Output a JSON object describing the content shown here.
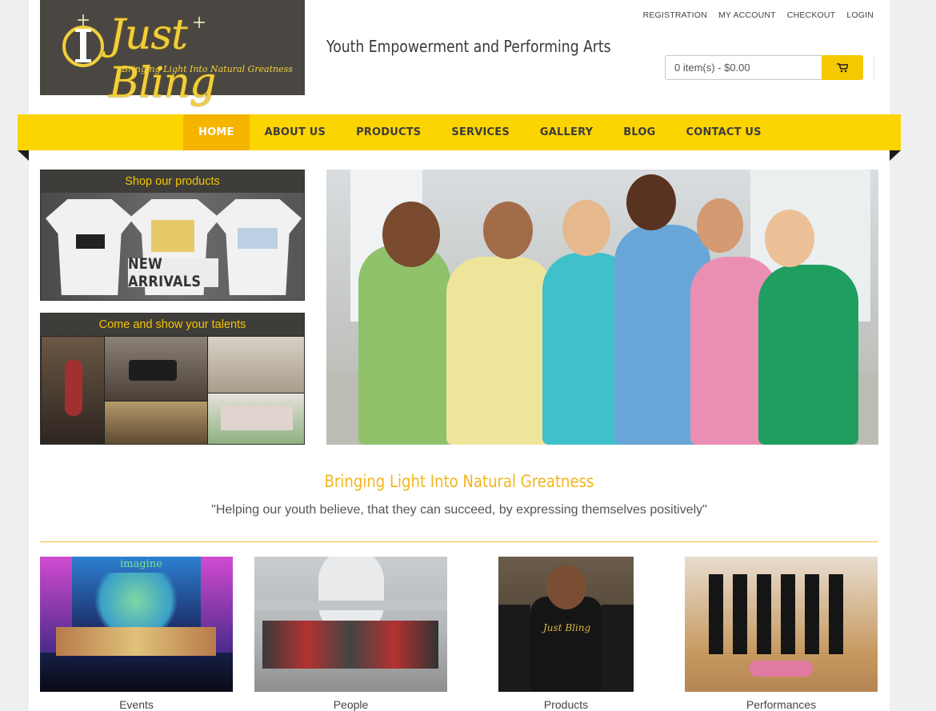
{
  "header": {
    "logo_text": "Just Bling",
    "logo_tagline": "Bringing Light Into Natural Greatness",
    "tagline": "Youth Empowerment and Performing Arts",
    "top_links": [
      "REGISTRATION",
      "MY ACCOUNT",
      "CHECKOUT",
      "LOGIN"
    ],
    "cart": {
      "summary": "0 item(s) - $0.00",
      "icon": "cart-icon"
    }
  },
  "nav": {
    "items": [
      "HOME",
      "ABOUT US",
      "PRODUCTS",
      "SERVICES",
      "GALLERY",
      "BLOG",
      "CONTACT US"
    ],
    "active": "HOME"
  },
  "side_panels": {
    "shop": {
      "title": "Shop our products",
      "badge": "NEW ARRIVALS"
    },
    "talent": {
      "title": "Come and show your talents"
    }
  },
  "mid": {
    "title": "Bringing Light Into Natural Greatness",
    "quote": "\"Helping our youth believe, that they can succeed, by expressing themselves positively\""
  },
  "cards": [
    {
      "caption": "Events",
      "overlay": "imagine"
    },
    {
      "caption": "People"
    },
    {
      "caption": "Products",
      "overlay": "Just Bling"
    },
    {
      "caption": "Performances"
    }
  ],
  "colors": {
    "accent": "#fcd400",
    "accent_active": "#f5b400",
    "title_gold": "#f2b61d",
    "logo_bg": "#4a4742"
  }
}
